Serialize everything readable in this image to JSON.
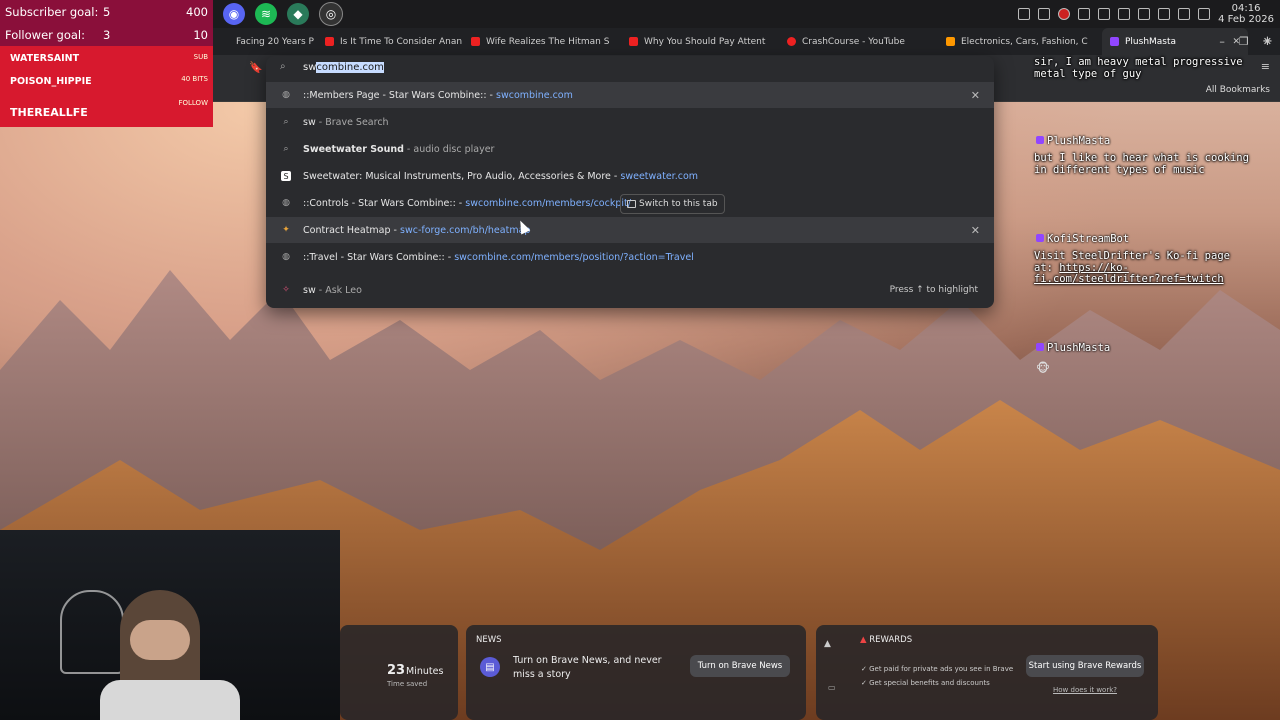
{
  "overlay": {
    "subscriber_goal_label": "Subscriber goal:",
    "subscriber_goal_current": "5",
    "subscriber_goal_target": "400",
    "follower_goal_label": "Follower goal:",
    "follower_goal_current": "3",
    "follower_goal_target": "10",
    "events": [
      {
        "name": "WATERSAINT",
        "type": "SUB"
      },
      {
        "name": "POISON_HIPPIE",
        "type": "40 BITS"
      },
      {
        "name": "THEREALLFE",
        "type": "FOLLOW"
      }
    ]
  },
  "tabs": [
    {
      "label": "Facing 20 Years P",
      "color": "#c43"
    },
    {
      "label": "Is It Time To Consider Anan",
      "color": "#e22"
    },
    {
      "label": "Wife Realizes The Hitman S",
      "color": "#e22"
    },
    {
      "label": "Why You Should Pay Attent",
      "color": "#e22"
    },
    {
      "label": "CrashCourse - YouTube",
      "color": "#e22"
    },
    {
      "label": "Electronics, Cars, Fashion, C",
      "color": "#f90"
    },
    {
      "label": "PlushMasta",
      "color": "#9146ff"
    }
  ],
  "omnibox": {
    "typed": "sw",
    "autocomplete": "combine.com",
    "suggestions": [
      {
        "title": "::Members Page - Star Wars Combine:: - ",
        "url": "swcombine.com",
        "icon": "globe-icon",
        "removable": true
      },
      {
        "title": "sw",
        "url": "",
        "suffix": " - Brave Search",
        "icon": "search-icon",
        "removable": false
      },
      {
        "title": "Sweetwater Sound",
        "url": "",
        "suffix": " - audio disc player",
        "icon": "search-icon",
        "removable": false
      },
      {
        "title": "Sweetwater: Musical Instruments, Pro Audio, Accessories & More - ",
        "url": "sweetwater.com",
        "icon": "sweetwater-icon",
        "removable": false
      },
      {
        "title": "::Controls - Star Wars Combine:: - ",
        "url": "swcombine.com/members/cockpit/",
        "icon": "globe-icon",
        "removable": false
      },
      {
        "title": "Contract Heatmap - ",
        "url": "swc-forge.com/bh/heatmap",
        "icon": "heatmap-icon",
        "removable": true
      },
      {
        "title": "::Travel - Star Wars Combine:: - ",
        "url": "swcombine.com/members/position/?action=Travel",
        "icon": "globe-icon",
        "removable": false
      },
      {
        "title": "sw",
        "url": "",
        "suffix": " - Ask Leo",
        "icon": "leo-icon",
        "removable": false
      }
    ],
    "switch_tab_label": "Switch to this tab",
    "highlight_hint": "Press ↑ to highlight"
  },
  "toolbar": {
    "all_bookmarks": "All Bookmarks"
  },
  "chat": [
    {
      "name": "",
      "message": "sir, I am heavy metal progressive metal type of guy"
    },
    {
      "name": "PlushMasta",
      "message": "but I like to hear what is cooking in different types of music"
    },
    {
      "name": "KofiStreamBot",
      "message": "Visit SteelDrifter's Ko-fi page at: ",
      "link": "https://ko-fi.com/steeldrifter?ref=twitch"
    },
    {
      "name": "PlushMasta",
      "message": ""
    }
  ],
  "clock": {
    "time": "04:16",
    "date": "4 Feb 2026"
  },
  "newtab": {
    "time_saved_value": "23",
    "time_saved_unit": "Minutes",
    "time_saved_label": "Time saved",
    "news_title": "NEWS",
    "news_text": "Turn on Brave News, and never miss a story",
    "news_button": "Turn on Brave News",
    "rewards_title": "REWARDS",
    "rewards_line1": "Get paid for private ads you see in Brave",
    "rewards_line2": "Get special benefits and discounts",
    "rewards_button": "Start using Brave Rewards",
    "rewards_link": "How does it work?"
  }
}
